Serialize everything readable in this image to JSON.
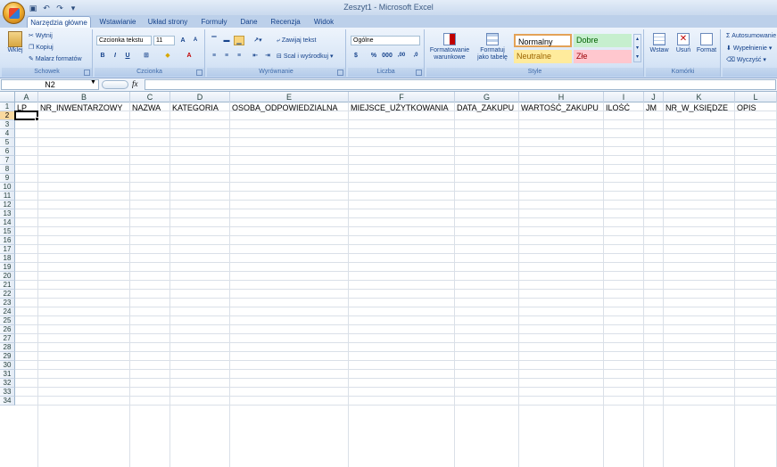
{
  "window": {
    "title": "Zeszyt1 - Microsoft Excel"
  },
  "qat": {
    "save_icon": "save-icon",
    "undo_icon": "undo-icon",
    "redo_icon": "redo-icon"
  },
  "tabs": [
    "Narzędzia główne",
    "Wstawianie",
    "Układ strony",
    "Formuły",
    "Dane",
    "Recenzja",
    "Widok"
  ],
  "ribbon": {
    "clipboard": {
      "label": "Schowek",
      "paste": "Wklej",
      "cut": "Wytnij",
      "copy": "Kopiuj",
      "format_painter": "Malarz formatów"
    },
    "font": {
      "label": "Czcionka",
      "font_name": "Czcionka tekstu",
      "font_size": "11",
      "bold": "B",
      "italic": "I",
      "underline": "U",
      "grow": "A",
      "shrink": "A"
    },
    "alignment": {
      "label": "Wyrównanie",
      "wrap": "Zawijaj tekst",
      "merge": "Scal i wyśrodkuj"
    },
    "number": {
      "label": "Liczba",
      "format": "Ogólne",
      "percent": "%",
      "thousands": "000",
      "inc_dec": ",00",
      "dec_dec": ",0"
    },
    "styles": {
      "label": "Style",
      "conditional": [
        "Formatowanie",
        "warunkowe"
      ],
      "as_table": [
        "Formatuj",
        "jako tabelę"
      ],
      "normal": "Normalny",
      "good": "Dobre",
      "neutral": "Neutralne",
      "bad": "Złe"
    },
    "cells": {
      "label": "Komórki",
      "insert": "Wstaw",
      "delete": "Usuń",
      "format": "Format"
    },
    "editing": {
      "autosum": "Autosumowanie",
      "fill": "Wypełnienie",
      "clear": "Wyczyść"
    }
  },
  "formula_bar": {
    "name_box": "N2",
    "fx": "fx",
    "content": ""
  },
  "columns": [
    "A",
    "B",
    "C",
    "D",
    "E",
    "F",
    "G",
    "H",
    "I",
    "J",
    "K",
    "L"
  ],
  "rows": [
    "1",
    "2",
    "3",
    "4",
    "5",
    "6",
    "7",
    "8",
    "9",
    "10",
    "11",
    "12",
    "13",
    "14",
    "15",
    "16",
    "17",
    "18",
    "19",
    "20",
    "21",
    "22",
    "23",
    "24",
    "25",
    "26",
    "27",
    "28",
    "29",
    "30",
    "31",
    "32",
    "33",
    "34"
  ],
  "row1": [
    "LP",
    "NR_INWENTARZOWY",
    "NAZWA",
    "KATEGORIA",
    "OSOBA_ODPOWIEDZIALNA",
    "MIEJSCE_UŻYTKOWANIA",
    "DATA_ZAKUPU",
    "WARTOŚĆ_ZAKUPU",
    "ILOŚĆ",
    "JM",
    "NR_W_KSIĘDZE",
    "OPIS"
  ],
  "colors": {
    "selection": "#000000",
    "ribbon_blue": "#15428b",
    "style_good": "#c6efce",
    "style_neutral": "#ffeb9c",
    "style_bad": "#ffc7ce"
  }
}
